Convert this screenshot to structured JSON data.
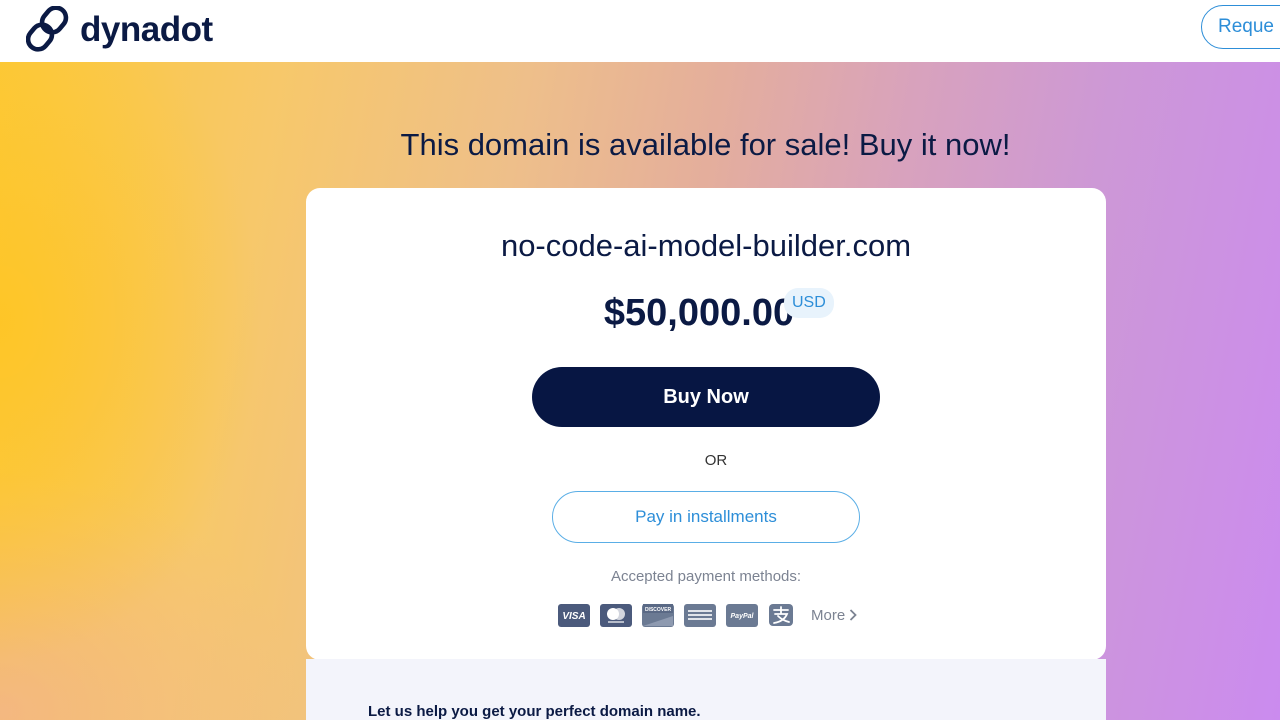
{
  "header": {
    "brand": "dynadot",
    "request_label": "Reque"
  },
  "hero": {
    "headline": "This domain is available for sale! Buy it now!"
  },
  "listing": {
    "domain": "no-code-ai-model-builder.com",
    "price": "$50,000.00",
    "currency": "USD",
    "buy_label": "Buy Now",
    "or_label": "OR",
    "installments_label": "Pay in installments",
    "accepted_label": "Accepted payment methods:",
    "payment_methods": [
      "visa",
      "mastercard",
      "discover",
      "amex",
      "paypal",
      "alipay"
    ],
    "more_label": "More"
  },
  "lower": {
    "help_text": "Let us help you get your perfect domain name."
  },
  "colors": {
    "navy": "#0b1a44",
    "button": "#071643",
    "accent_blue": "#2d8ed8",
    "gradient_left": "#fcc93a",
    "gradient_right": "#cb8bef"
  }
}
